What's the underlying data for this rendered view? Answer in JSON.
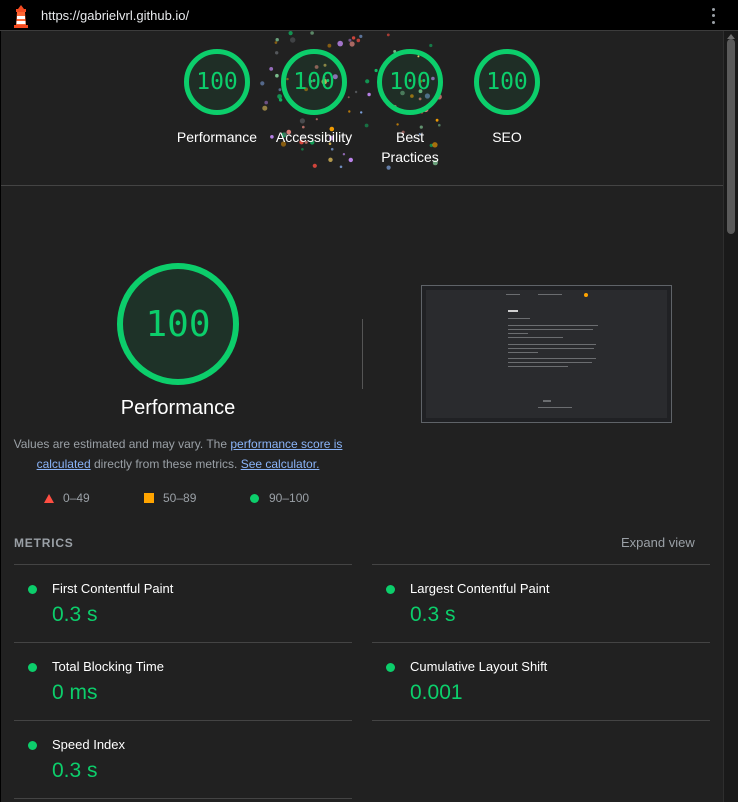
{
  "browser": {
    "url": "https://gabrielvrl.github.io/"
  },
  "colors": {
    "pass": "#0cce6b",
    "average": "#ffa400",
    "fail": "#ff4e42",
    "link": "#8ab4f8"
  },
  "header_gauges": [
    {
      "label": "Performance",
      "score": "100"
    },
    {
      "label": "Accessibility",
      "score": "100"
    },
    {
      "label": "Best Practices",
      "score": "100"
    },
    {
      "label": "SEO",
      "score": "100"
    }
  ],
  "performance": {
    "score": "100",
    "title": "Performance",
    "desc_part1": "Values are estimated and may vary. The ",
    "desc_link1": "performance score is calculated",
    "desc_part2": " directly from these metrics. ",
    "desc_link2": "See calculator."
  },
  "legend": [
    {
      "shape": "triangle",
      "range": "0–49"
    },
    {
      "shape": "square",
      "range": "50–89"
    },
    {
      "shape": "circle",
      "range": "90–100"
    }
  ],
  "metrics": {
    "title": "METRICS",
    "expand_label": "Expand view",
    "items": [
      {
        "name": "First Contentful Paint",
        "value": "0.3 s"
      },
      {
        "name": "Largest Contentful Paint",
        "value": "0.3 s"
      },
      {
        "name": "Total Blocking Time",
        "value": "0 ms"
      },
      {
        "name": "Cumulative Layout Shift",
        "value": "0.001"
      },
      {
        "name": "Speed Index",
        "value": "0.3 s"
      }
    ]
  }
}
